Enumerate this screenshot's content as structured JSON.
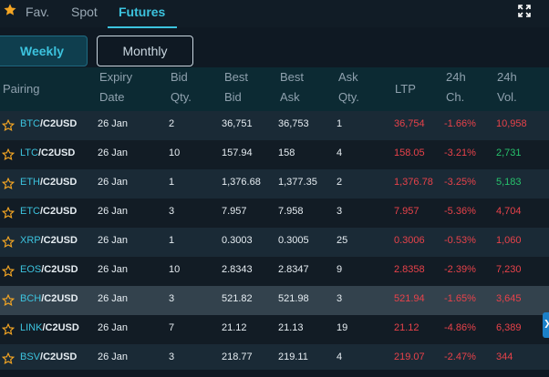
{
  "nav": {
    "tabs": [
      {
        "label": "Fav.",
        "active": false
      },
      {
        "label": "Spot",
        "active": false
      },
      {
        "label": "Futures",
        "active": true
      }
    ]
  },
  "toggles": {
    "weekly": "Weekly",
    "monthly": "Monthly",
    "selected": "Weekly"
  },
  "table": {
    "headers": [
      [
        "Pairing"
      ],
      [
        "Expiry",
        "Date"
      ],
      [
        "Bid",
        "Qty."
      ],
      [
        "Best",
        "Bid"
      ],
      [
        "Best",
        "Ask"
      ],
      [
        "Ask",
        "Qty."
      ],
      [
        "LTP"
      ],
      [
        "24h",
        "Ch."
      ],
      [
        "24h",
        "Vol."
      ]
    ],
    "rows": [
      {
        "base": "BTC",
        "quote": "/C2USD",
        "expiry": "26 Jan",
        "bid_qty": "2",
        "best_bid": "36,751",
        "best_ask": "36,753",
        "ask_qty": "1",
        "ltp": "36,754",
        "ch": "-1.66%",
        "vol": "10,958",
        "vol_color": "red"
      },
      {
        "base": "LTC",
        "quote": "/C2USD",
        "expiry": "26 Jan",
        "bid_qty": "10",
        "best_bid": "157.94",
        "best_ask": "158",
        "ask_qty": "4",
        "ltp": "158.05",
        "ch": "-3.21%",
        "vol": "2,731",
        "vol_color": "green"
      },
      {
        "base": "ETH",
        "quote": "/C2USD",
        "expiry": "26 Jan",
        "bid_qty": "1",
        "best_bid": "1,376.68",
        "best_ask": "1,377.35",
        "ask_qty": "2",
        "ltp": "1,376.78",
        "ch": "-3.25%",
        "vol": "5,183",
        "vol_color": "green"
      },
      {
        "base": "ETC",
        "quote": "/C2USD",
        "expiry": "26 Jan",
        "bid_qty": "3",
        "best_bid": "7.957",
        "best_ask": "7.958",
        "ask_qty": "3",
        "ltp": "7.957",
        "ch": "-5.36%",
        "vol": "4,704",
        "vol_color": "red"
      },
      {
        "base": "XRP",
        "quote": "/C2USD",
        "expiry": "26 Jan",
        "bid_qty": "1",
        "best_bid": "0.3003",
        "best_ask": "0.3005",
        "ask_qty": "25",
        "ltp": "0.3006",
        "ch": "-0.53%",
        "vol": "1,060",
        "vol_color": "red"
      },
      {
        "base": "EOS",
        "quote": "/C2USD",
        "expiry": "26 Jan",
        "bid_qty": "10",
        "best_bid": "2.8343",
        "best_ask": "2.8347",
        "ask_qty": "9",
        "ltp": "2.8358",
        "ch": "-2.39%",
        "vol": "7,230",
        "vol_color": "red"
      },
      {
        "base": "BCH",
        "quote": "/C2USD",
        "expiry": "26 Jan",
        "bid_qty": "3",
        "best_bid": "521.82",
        "best_ask": "521.98",
        "ask_qty": "3",
        "ltp": "521.94",
        "ch": "-1.65%",
        "vol": "3,645",
        "vol_color": "red"
      },
      {
        "base": "LINK",
        "quote": "/C2USD",
        "expiry": "26 Jan",
        "bid_qty": "7",
        "best_bid": "21.12",
        "best_ask": "21.13",
        "ask_qty": "19",
        "ltp": "21.12",
        "ch": "-4.86%",
        "vol": "6,389",
        "vol_color": "red"
      },
      {
        "base": "BSV",
        "quote": "/C2USD",
        "expiry": "26 Jan",
        "bid_qty": "3",
        "best_bid": "218.77",
        "best_ask": "219.11",
        "ask_qty": "4",
        "ltp": "219.07",
        "ch": "-2.47%",
        "vol": "344",
        "vol_color": "red"
      }
    ]
  },
  "colors": {
    "accent": "#3cc3de",
    "negative": "#e8424a",
    "positive": "#27c26c",
    "star": "#f5a623"
  },
  "icons": {
    "favorite": "star-icon",
    "fullscreen": "expand-icon",
    "panel": "chevron-right-icon"
  }
}
